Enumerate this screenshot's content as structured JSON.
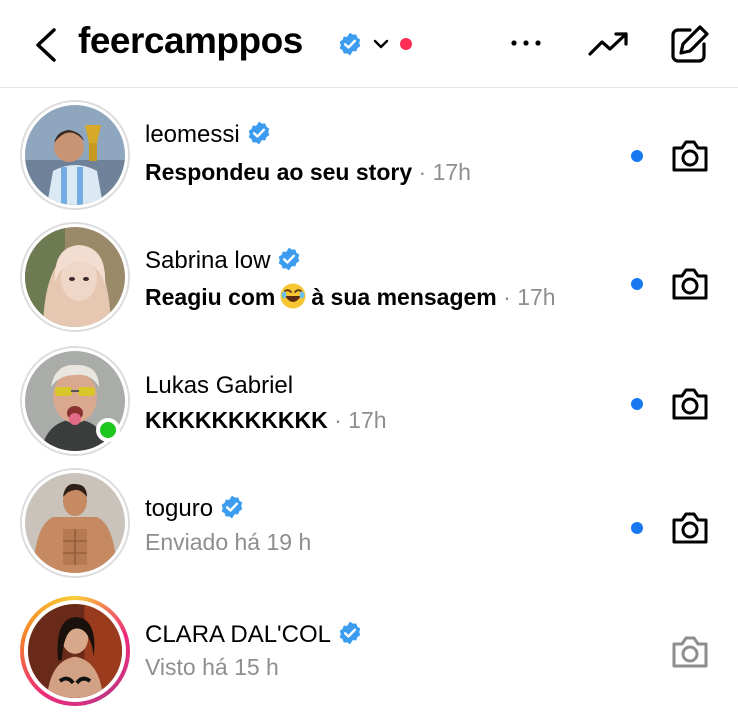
{
  "header": {
    "username": "feercamppos",
    "icons": {
      "back": "chevron-left-icon",
      "verified": "verified-badge-icon",
      "dropdown": "chevron-down-icon",
      "more": "more-horizontal-icon",
      "trending": "trending-up-icon",
      "compose": "compose-icon"
    }
  },
  "colors": {
    "verified_blue": "#3b9cf0",
    "unread_dot": "#1877f2",
    "notification_dot": "#ff2d55",
    "online": "#1ec71e",
    "muted_text": "#8e8e8e"
  },
  "conversations": [
    {
      "name": "leomessi",
      "verified": true,
      "message": "Respondeu ao seu story",
      "time": "· 17h",
      "unread": true,
      "online": false,
      "story_ring": false
    },
    {
      "name": "Sabrina low",
      "verified": true,
      "message_before_emoji": "Reagiu com",
      "emoji": "😂",
      "message_after_emoji": "à sua mensagem",
      "time": "· 17h",
      "unread": true,
      "online": false,
      "story_ring": false
    },
    {
      "name": "Lukas Gabriel",
      "verified": false,
      "message": "KKKKKKKKKKK",
      "time": "· 17h",
      "unread": true,
      "online": true,
      "story_ring": false
    },
    {
      "name": "toguro",
      "verified": true,
      "message": "Enviado há 19 h",
      "unread": true,
      "online": false,
      "story_ring": false
    },
    {
      "name": "CLARA DAL'COL",
      "verified": true,
      "message": "Visto há 15 h",
      "unread": false,
      "online": false,
      "story_ring": true
    }
  ]
}
